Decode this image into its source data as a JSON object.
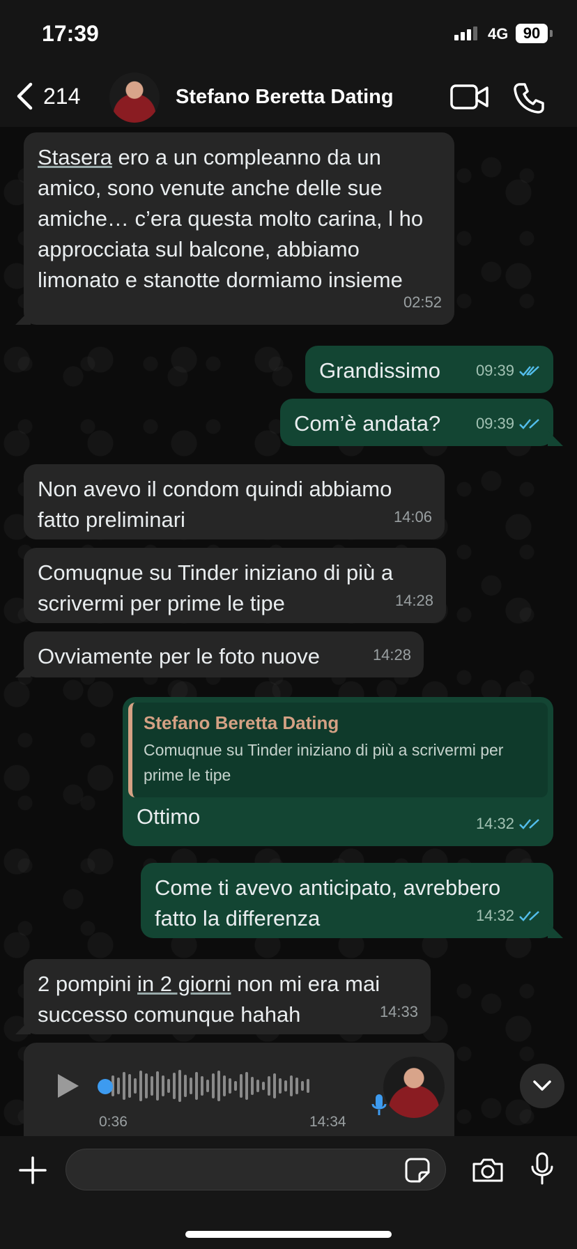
{
  "status_bar": {
    "time": "17:39",
    "network": "4G",
    "battery": "90"
  },
  "header": {
    "back_count": "214",
    "contact_name": "Stefano Beretta Dating"
  },
  "messages": [
    {
      "text_underlined": "Stasera",
      "text": " ero a un compleanno da un amico, sono venute anche delle sue amiche… c’era questa molto carina, l ho approcciata sul balcone, abbiamo limonato e stanotte dormiamo insieme",
      "time": "02:52"
    },
    {
      "text": "Grandissimo",
      "time": "09:39"
    },
    {
      "text": "Com’è andata?",
      "time": "09:39"
    },
    {
      "text": "Non avevo il condom quindi abbiamo fatto preliminari",
      "time": "14:06"
    },
    {
      "text": "Comuqnue su Tinder iniziano di più a scrivermi per prime le tipe",
      "time": "14:28"
    },
    {
      "text": "Ovviamente per le foto nuove",
      "time": "14:28"
    },
    {
      "quote_name": "Stefano Beretta Dating",
      "quote_text": "Comuqnue su Tinder iniziano di più a scrivermi per prime le tipe",
      "text": "Ottimo",
      "time": "14:32"
    },
    {
      "text": "Come ti avevo anticipato, avrebbero fatto la differenza",
      "time": "14:32"
    },
    {
      "text_pre": "2 pompini ",
      "text_underlined": "in 2 giorni",
      "text_post": " non mi era mai successo comunque hahah",
      "time": "14:33"
    }
  ],
  "voice_note": {
    "duration": "0:36",
    "time": "14:34"
  },
  "composer": {
    "placeholder": ""
  },
  "colors": {
    "incoming": "#262626",
    "outgoing": "#134533",
    "read_tick": "#53bdeb",
    "quote_accent": "#d4a184"
  }
}
